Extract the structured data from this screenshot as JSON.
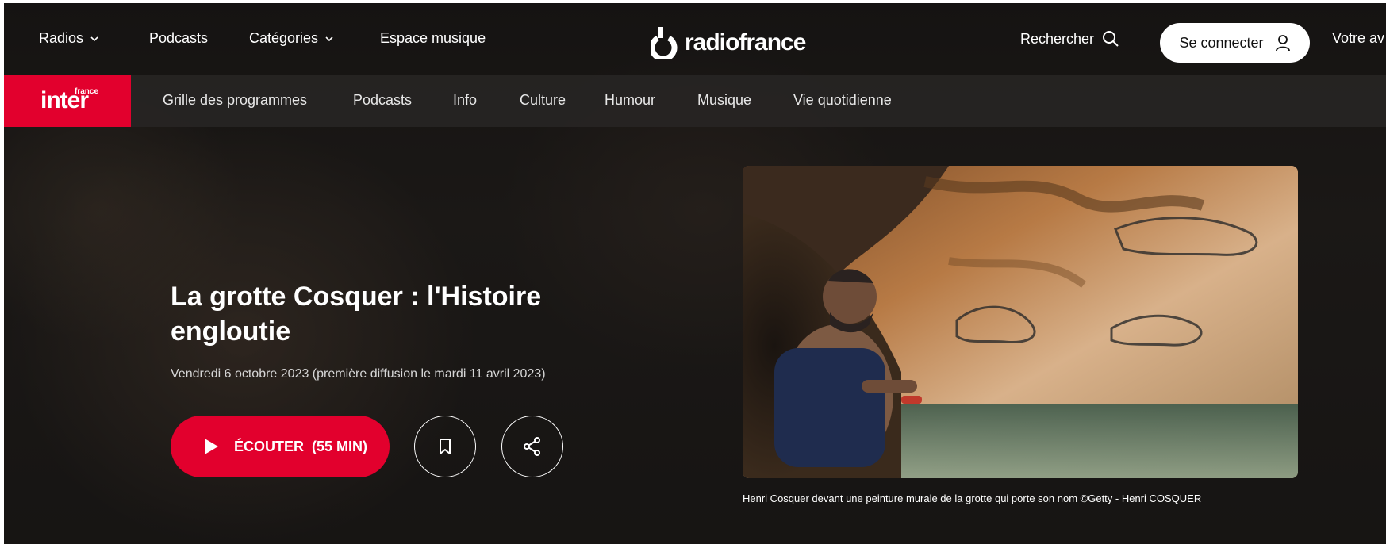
{
  "topbar": {
    "nav": [
      {
        "label": "Radios",
        "has_dropdown": true
      },
      {
        "label": "Podcasts",
        "has_dropdown": false
      },
      {
        "label": "Catégories",
        "has_dropdown": true
      },
      {
        "label": "Espace musique",
        "has_dropdown": false
      }
    ],
    "brand": "radiofrance",
    "search_label": "Rechercher",
    "connect_label": "Se connecter",
    "votre_label": "Votre av"
  },
  "station": {
    "name": "inter",
    "name_small": "france"
  },
  "subnav": {
    "items": [
      "Grille des programmes",
      "Podcasts",
      "Info",
      "Culture",
      "Humour",
      "Musique",
      "Vie quotidienne"
    ]
  },
  "episode": {
    "title": "La grotte Cosquer : l'Histoire engloutie",
    "date_line": "Vendredi 6 octobre 2023 (première diffusion le mardi 11 avril 2023)",
    "listen_label": "ÉCOUTER",
    "duration_label": "(55 MIN)",
    "caption": "Henri Cosquer devant une peinture murale de la grotte qui porte son nom ©Getty - Henri COSQUER"
  },
  "colors": {
    "accent_red": "#e2002d",
    "text_white": "#ffffff"
  }
}
